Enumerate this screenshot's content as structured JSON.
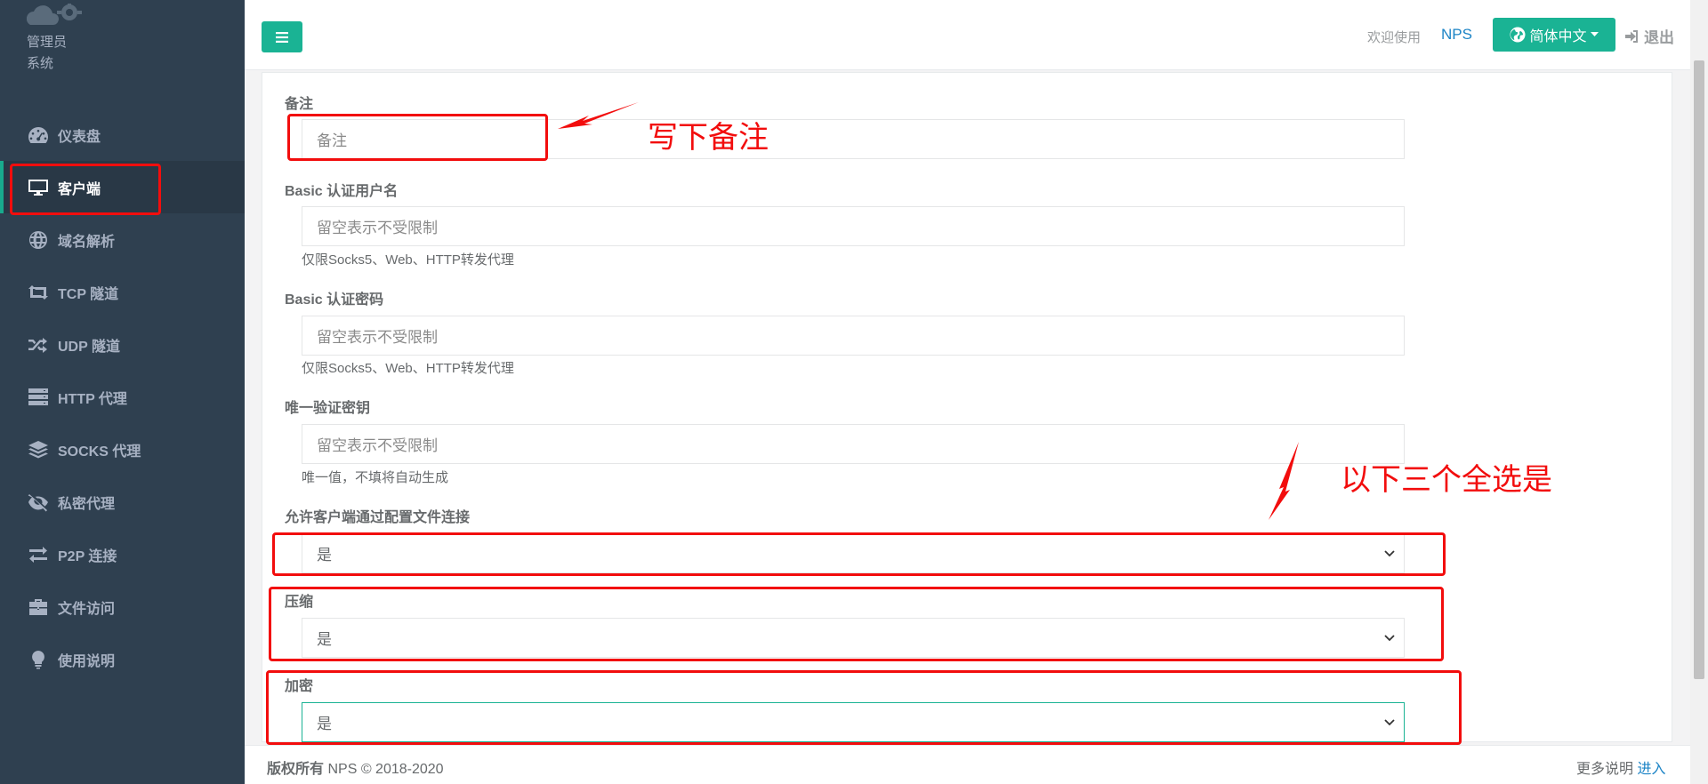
{
  "sidebar": {
    "brand_line1": "管理员",
    "brand_line2": "系统",
    "items": [
      {
        "label": "仪表盘",
        "icon": "dashboard-icon"
      },
      {
        "label": "客户端",
        "icon": "desktop-icon",
        "active": true
      },
      {
        "label": "域名解析",
        "icon": "globe-icon"
      },
      {
        "label": "TCP 隧道",
        "icon": "retweet-icon"
      },
      {
        "label": "UDP 隧道",
        "icon": "random-icon"
      },
      {
        "label": "HTTP 代理",
        "icon": "server-icon"
      },
      {
        "label": "SOCKS 代理",
        "icon": "layers-icon"
      },
      {
        "label": "私密代理",
        "icon": "eye-slash-icon"
      },
      {
        "label": "P2P 连接",
        "icon": "exchange-icon"
      },
      {
        "label": "文件访问",
        "icon": "briefcase-icon"
      },
      {
        "label": "使用说明",
        "icon": "lightbulb-icon"
      }
    ]
  },
  "topbar": {
    "welcome": "欢迎使用",
    "app_name": "NPS",
    "language": "简体中文",
    "logout": "退出"
  },
  "form": {
    "remark_label": "备注",
    "remark_placeholder": "备注",
    "basic_user_label": "Basic 认证用户名",
    "basic_user_placeholder": "留空表示不受限制",
    "basic_user_help": "仅限Socks5、Web、HTTP转发代理",
    "basic_pass_label": "Basic 认证密码",
    "basic_pass_placeholder": "留空表示不受限制",
    "basic_pass_help": "仅限Socks5、Web、HTTP转发代理",
    "vkey_label": "唯一验证密钥",
    "vkey_placeholder": "留空表示不受限制",
    "vkey_help": "唯一值，不填将自动生成",
    "config_conn_label": "允许客户端通过配置文件连接",
    "config_conn_value": "是",
    "compress_label": "压缩",
    "compress_value": "是",
    "crypt_label": "加密",
    "crypt_value": "是"
  },
  "annotations": {
    "remark_note": "写下备注",
    "select_note": "以下三个全选是",
    "color": "#f20d0d"
  },
  "footer": {
    "copyright_bold": "版权所有",
    "copyright_text": "NPS © 2018-2020",
    "more_text": "更多说明",
    "more_link": "进入"
  },
  "colors": {
    "sidebar_bg": "#2f4050",
    "accent": "#1ab394",
    "link": "#1c84c6"
  }
}
